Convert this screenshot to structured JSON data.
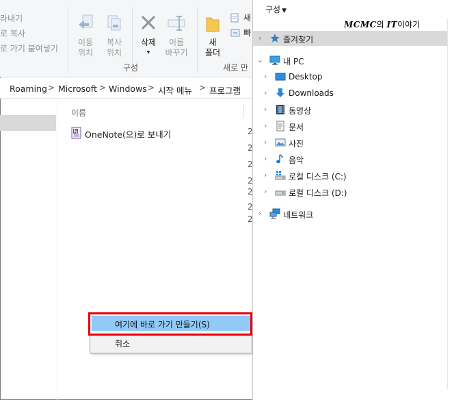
{
  "ribbon": {
    "partial_labels": [
      "라내기",
      "로 복사",
      "로 가기 붙여넣기"
    ],
    "move_to": [
      "이동",
      "위치"
    ],
    "copy_to": [
      "복사",
      "위치"
    ],
    "delete": "삭제",
    "rename": [
      "이름",
      "바꾸기"
    ],
    "new_folder": [
      "새",
      "폴더"
    ],
    "new_items": [
      "새",
      "빠"
    ],
    "organize_group": "구성",
    "new_group": "새로 만"
  },
  "address": {
    "crumbs": [
      "Roaming",
      "Microsoft",
      "Windows",
      "시작 메뉴",
      "프로그램"
    ],
    "separator": ">"
  },
  "file_list": {
    "name_header": "이름",
    "items": [
      {
        "name": "OneNote(으)로 보내기",
        "icon": "onenote-icon"
      }
    ],
    "partial_dates": [
      "2",
      "2",
      "2",
      "2",
      "2",
      "2",
      "2"
    ]
  },
  "context_menu": {
    "items": [
      "여기에 바로 가기 만들기(S)",
      "취소"
    ],
    "highlight_color": "#91c9f7",
    "annotation_color": "#e8000b"
  },
  "right_pane": {
    "organize": "구성",
    "watermark_brand": "MCMC",
    "watermark_mid": "의 ",
    "watermark_it": "IT",
    "watermark_tail": "이야기",
    "tree": [
      {
        "label": "즐겨찾기",
        "icon": "star-icon",
        "chevron": "›",
        "selected": true
      },
      {
        "label": "내 PC",
        "icon": "pc-icon",
        "chevron": "⌄"
      },
      {
        "label": "Desktop",
        "icon": "desktop-icon",
        "chevron": "›"
      },
      {
        "label": "Downloads",
        "icon": "downloads-icon",
        "chevron": "›"
      },
      {
        "label": "동영상",
        "icon": "video-icon",
        "chevron": "›"
      },
      {
        "label": "문서",
        "icon": "document-icon",
        "chevron": "›"
      },
      {
        "label": "사진",
        "icon": "picture-icon",
        "chevron": "›"
      },
      {
        "label": "음악",
        "icon": "music-icon",
        "chevron": "›"
      },
      {
        "label": "로컬 디스크 (C:)",
        "icon": "windows-drive-icon",
        "chevron": "›"
      },
      {
        "label": "로컬 디스크 (D:)",
        "icon": "drive-icon",
        "chevron": "›"
      },
      {
        "label": "네트워크",
        "icon": "network-icon",
        "chevron": "›"
      }
    ]
  }
}
